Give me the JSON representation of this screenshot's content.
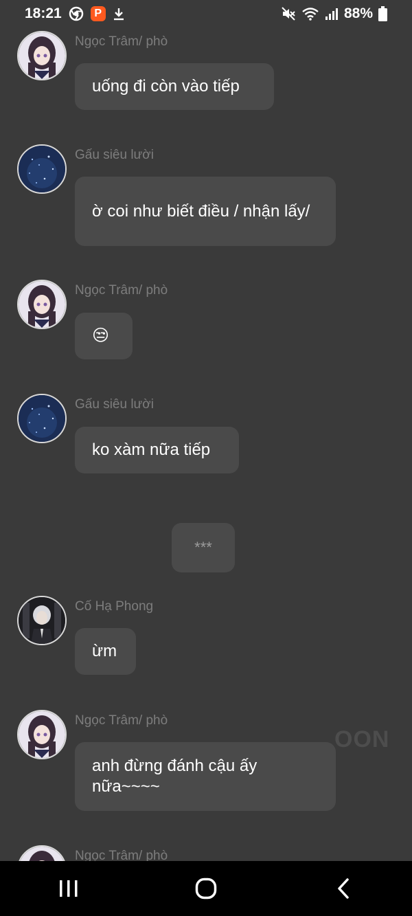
{
  "status_bar": {
    "time": "18:21",
    "battery": "88%",
    "icons": [
      "chrome-icon",
      "p-app-icon",
      "download-icon",
      "mute-icon",
      "wifi-icon",
      "signal-icon",
      "battery-icon"
    ]
  },
  "messages": [
    {
      "sender": "Ngọc Trâm/ phò",
      "avatar": "anime-girl-avatar",
      "text": "uống đi còn vào tiếp"
    },
    {
      "sender": "Gấu siêu lười",
      "avatar": "starry-night-avatar",
      "text": "ờ coi như biết điều / nhận lấy/"
    },
    {
      "sender": "Ngọc Trâm/ phò",
      "avatar": "anime-girl-avatar",
      "text": "😒"
    },
    {
      "sender": "Gấu siêu lười",
      "avatar": "starry-night-avatar",
      "text": "ko xàm nữa tiếp"
    },
    {
      "sender": "Cố Hạ Phong",
      "avatar": "white-hair-man-avatar",
      "text": "ừm"
    },
    {
      "sender": "Ngọc Trâm/ phò",
      "avatar": "anime-girl-avatar",
      "text": "anh đừng đánh cậu ấy nữa~~~~"
    },
    {
      "sender": "Ngọc Trâm/ phò",
      "avatar": "anime-girl-avatar",
      "text": ""
    }
  ],
  "divider": "***",
  "watermark": "OON",
  "nav": {
    "buttons": [
      "recents-button",
      "home-button",
      "back-button"
    ]
  }
}
